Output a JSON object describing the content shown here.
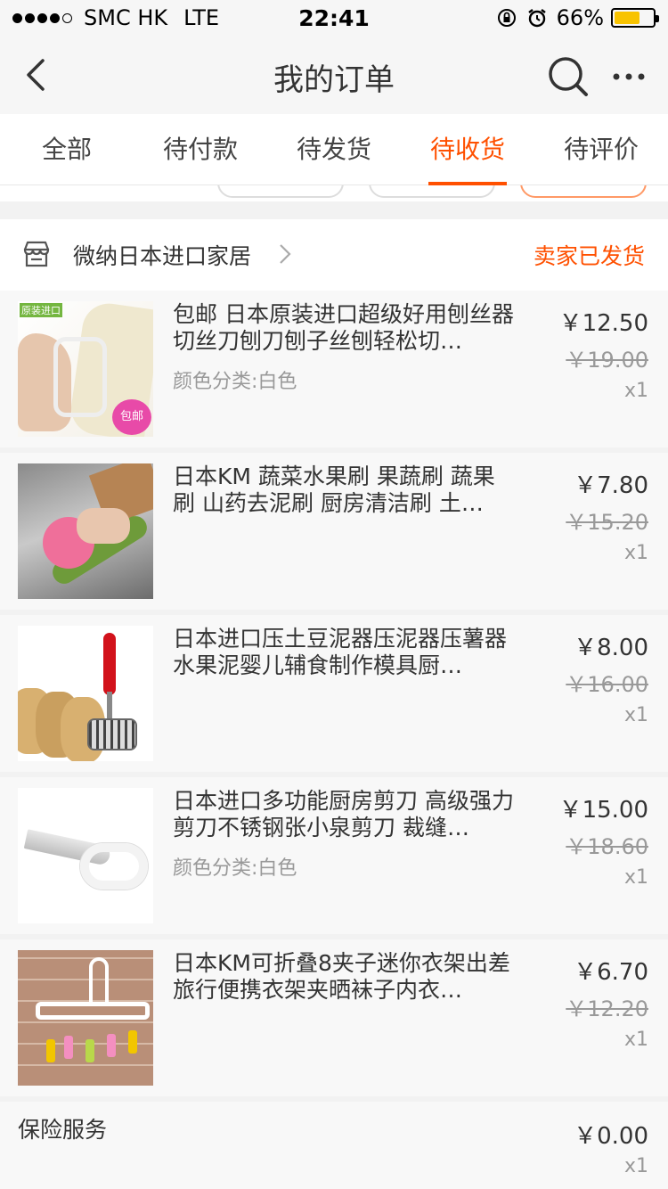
{
  "status_bar": {
    "carrier": "SMC HK",
    "network": "LTE",
    "time": "22:41",
    "battery": "66%",
    "battery_level": 0.66
  },
  "nav": {
    "title": "我的订单"
  },
  "tabs": [
    {
      "label": "全部",
      "active": false
    },
    {
      "label": "待付款",
      "active": false
    },
    {
      "label": "待发货",
      "active": false
    },
    {
      "label": "待收货",
      "active": true
    },
    {
      "label": "待评价",
      "active": false
    }
  ],
  "shop": {
    "name": "微纳日本进口家居",
    "status": "卖家已发货"
  },
  "items": [
    {
      "title": "包邮 日本原装进口超级好用刨丝器切丝刀刨刀刨子丝刨轻松切…",
      "sku": "颜色分类:白色",
      "price": "￥12.50",
      "original_price": "￥19.00",
      "qty": "x1",
      "thumb_badge": "包邮",
      "thumb_tag": "原装进口"
    },
    {
      "title": "日本KM 蔬菜水果刷 果蔬刷 蔬果刷 山药去泥刷 厨房清洁刷 土…",
      "sku": "",
      "price": "￥7.80",
      "original_price": "￥15.20",
      "qty": "x1"
    },
    {
      "title": "日本进口压土豆泥器压泥器压薯器水果泥婴儿辅食制作模具厨…",
      "sku": "",
      "price": "￥8.00",
      "original_price": "￥16.00",
      "qty": "x1"
    },
    {
      "title": "日本进口多功能厨房剪刀 高级强力剪刀不锈钢张小泉剪刀 裁缝…",
      "sku": "颜色分类:白色",
      "price": "￥15.00",
      "original_price": "￥18.60",
      "qty": "x1"
    },
    {
      "title": "日本KM可折叠8夹子迷你衣架出差旅行便携衣架夹晒袜子内衣…",
      "sku": "",
      "price": "￥6.70",
      "original_price": "￥12.20",
      "qty": "x1"
    }
  ],
  "insurance": {
    "label": "保险服务",
    "price": "￥0.00",
    "qty": "x1"
  },
  "colors": {
    "accent": "#ff5000",
    "text": "#333333",
    "muted": "#999999"
  }
}
